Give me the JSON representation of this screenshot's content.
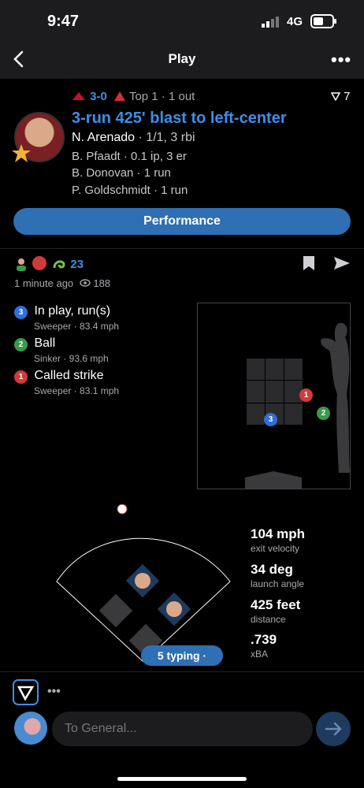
{
  "status_bar": {
    "time": "9:47",
    "network": "4G"
  },
  "nav": {
    "title": "Play",
    "back_icon": "chevron-left-icon",
    "more_label": "•••"
  },
  "play": {
    "score": "3-0",
    "inning": "Top 1 · 1 out",
    "reactions": "7",
    "headline": "3-run 425' blast to left-center",
    "batter": "N. Arenado",
    "batter_line": "· 1/1, 3 rbi",
    "pitcher_line": "B. Pfaadt · 0.1 ip, 3 er",
    "runner1": "B. Donovan · 1 run",
    "runner2": "P. Goldschmidt · 1 run",
    "performance_label": "Performance"
  },
  "meta": {
    "count": "23",
    "time_ago": "1 minute ago",
    "views": "188"
  },
  "pitches": [
    {
      "num": "3",
      "result": "In play, run(s)",
      "detail": "Sweeper · 83.4 mph",
      "color": "#2f6fd6"
    },
    {
      "num": "2",
      "result": "Ball",
      "detail": "Sinker · 93.6 mph",
      "color": "#3a9a4a"
    },
    {
      "num": "1",
      "result": "Called strike",
      "detail": "Sweeper · 83.1 mph",
      "color": "#d23a3a"
    }
  ],
  "stats": [
    {
      "value": "104 mph",
      "label": "exit velocity"
    },
    {
      "value": "34 deg",
      "label": "launch angle"
    },
    {
      "value": "425 feet",
      "label": "distance"
    },
    {
      "value": ".739",
      "label": "xBA"
    }
  ],
  "typing_label": "5 typing ·",
  "chat": {
    "placeholder": "To General..."
  },
  "more_dots": "•••"
}
